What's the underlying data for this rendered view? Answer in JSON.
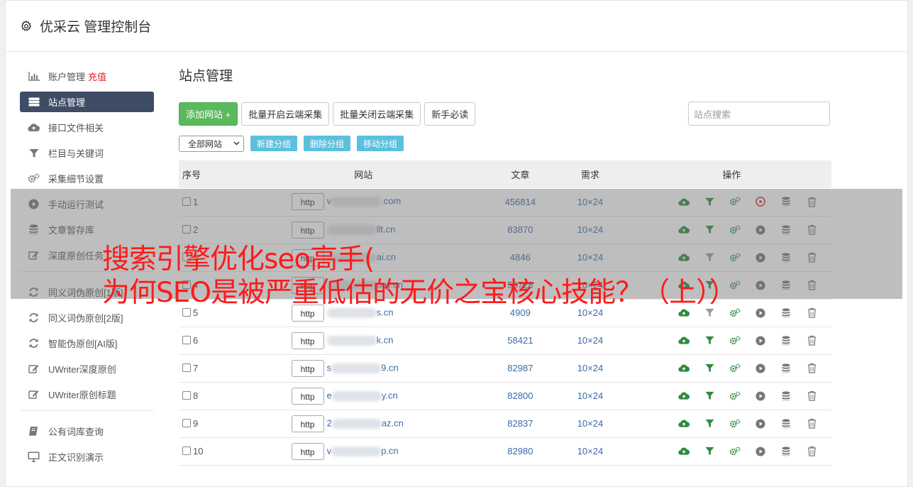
{
  "app": {
    "title": "优采云 管理控制台"
  },
  "sidebar": {
    "items": [
      {
        "label": "账户管理",
        "extra": "充值",
        "icon": "bar-chart-icon"
      },
      {
        "label": "站点管理",
        "icon": "server-icon",
        "active": true
      },
      {
        "label": "接口文件相关",
        "icon": "cloud-upload-icon"
      },
      {
        "label": "栏目与关键词",
        "icon": "filter-icon"
      },
      {
        "label": "采集细节设置",
        "icon": "cogs-icon"
      },
      {
        "label": "手动运行测试",
        "icon": "play-circle-icon"
      },
      {
        "label": "文章暂存库",
        "icon": "database-icon"
      },
      {
        "label": "深度原创任务",
        "icon": "edit-icon"
      }
    ],
    "items2": [
      {
        "label": "同义词伪原创[1版]",
        "icon": "refresh-icon"
      },
      {
        "label": "同义词伪原创[2版]",
        "icon": "refresh-icon"
      },
      {
        "label": "智能伪原创[AI版]",
        "icon": "refresh-icon"
      },
      {
        "label": "UWriter深度原创",
        "icon": "edit-icon"
      },
      {
        "label": "UWriter原创标题",
        "icon": "edit-icon"
      }
    ],
    "items3": [
      {
        "label": "公有词库查询",
        "icon": "book-icon"
      },
      {
        "label": "正文识别演示",
        "icon": "monitor-icon"
      }
    ]
  },
  "main": {
    "title": "站点管理",
    "buttons": {
      "add": "添加网站 +",
      "batch_open": "批量开启云端采集",
      "batch_close": "批量关闭云端采集",
      "newbie": "新手必读"
    },
    "search_placeholder": "站点搜索",
    "group_select": "全部网站",
    "group_buttons": {
      "new": "新建分组",
      "delete": "删除分组",
      "move": "移动分组"
    },
    "table": {
      "headers": [
        "序号",
        "网站",
        "文章",
        "需求",
        "操作"
      ],
      "http_label": "http",
      "rows": [
        {
          "idx": "1",
          "pre": "v",
          "post": ".com",
          "articles": "456814",
          "need": "10×24",
          "running": true,
          "filter_active": true
        },
        {
          "idx": "2",
          "pre": "",
          "post": "llt.cn",
          "articles": "83870",
          "need": "10×24",
          "running": false,
          "filter_active": true
        },
        {
          "idx": "3",
          "pre": "",
          "post": "ai.cn",
          "articles": "4846",
          "need": "10×24",
          "running": false,
          "filter_active": false
        },
        {
          "idx": "4",
          "pre": "",
          "post": "pay.cn",
          "articles": "58728",
          "need": "10×24",
          "running": false,
          "filter_active": true
        },
        {
          "idx": "5",
          "pre": "",
          "post": "s.cn",
          "articles": "4909",
          "need": "10×24",
          "running": false,
          "filter_active": false
        },
        {
          "idx": "6",
          "pre": "",
          "post": "k.cn",
          "articles": "58421",
          "need": "10×24",
          "running": false,
          "filter_active": true
        },
        {
          "idx": "7",
          "pre": "s",
          "post": "9.cn",
          "articles": "82987",
          "need": "10×24",
          "running": false,
          "filter_active": true
        },
        {
          "idx": "8",
          "pre": "e",
          "post": "y.cn",
          "articles": "82800",
          "need": "10×24",
          "running": false,
          "filter_active": true
        },
        {
          "idx": "9",
          "pre": "2",
          "post": "az.cn",
          "articles": "82837",
          "need": "10×24",
          "running": false,
          "filter_active": true
        },
        {
          "idx": "10",
          "pre": "v",
          "post": "p.cn",
          "articles": "82980",
          "need": "10×24",
          "running": false,
          "filter_active": true
        }
      ]
    }
  },
  "overlay": {
    "line1": "搜索引擎优化seo高手(",
    "line2": "为何SEO是被严重低估的无价之宝核心技能？（上））"
  },
  "colors": {
    "green": "#5cb85c",
    "sidebar_active": "#3f4c66",
    "blue_btn": "#5bc0de",
    "link": "#3a6aa8",
    "red": "#e02020"
  }
}
